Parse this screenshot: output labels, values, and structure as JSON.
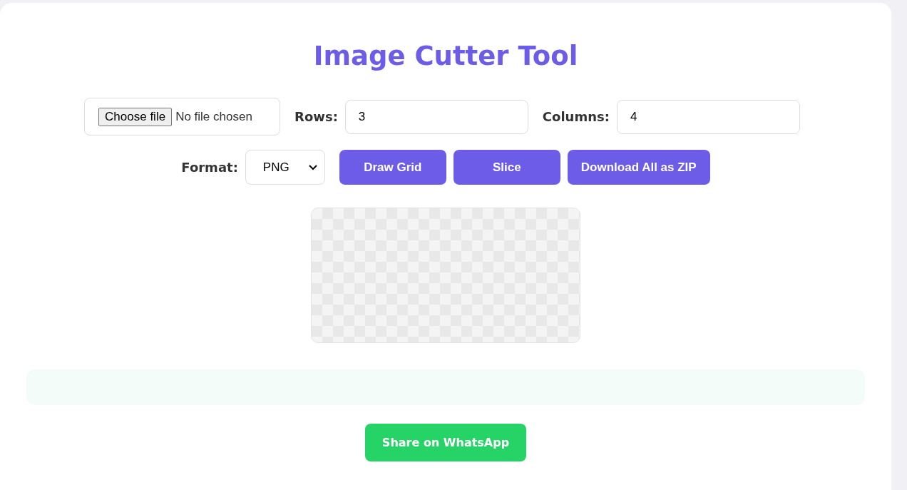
{
  "title": "Image Cutter Tool",
  "file_input": {
    "button": "Choose file",
    "status": "No file chosen"
  },
  "fields": [
    {
      "label": "Rows:",
      "value": "3"
    },
    {
      "label": "Columns:",
      "value": "4"
    }
  ],
  "format": {
    "label": "Format:",
    "value": "PNG"
  },
  "buttons": [
    "Draw Grid",
    "Slice",
    "Download All as ZIP"
  ],
  "share_button": "Share on WhatsApp"
}
